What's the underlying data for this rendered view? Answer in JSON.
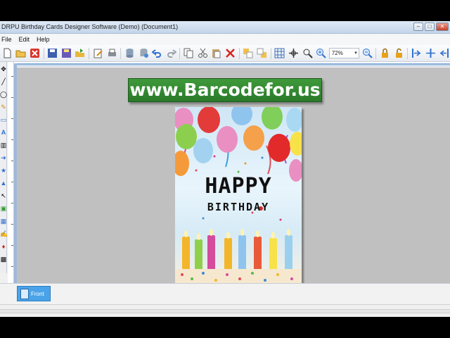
{
  "window": {
    "title": "DRPU Birthday Cards Designer Software (Demo) (Document1)",
    "controls": {
      "minimize": "–",
      "maximize": "□",
      "close": "✕"
    }
  },
  "menubar": {
    "items": [
      "File",
      "Edit",
      "Help"
    ]
  },
  "toolbar": {
    "zoom_value": "72%"
  },
  "watermark": {
    "text": "www.Barcodefor.us"
  },
  "card": {
    "line1": "HAPPY",
    "line2": "BIRTHDAY"
  },
  "pages": {
    "tabs": [
      {
        "label": "Front"
      }
    ]
  },
  "colors": {
    "watermark_bg": "#3a8f36",
    "page_tab": "#4aa3e8",
    "canvas_bg": "#c0c0c0"
  }
}
